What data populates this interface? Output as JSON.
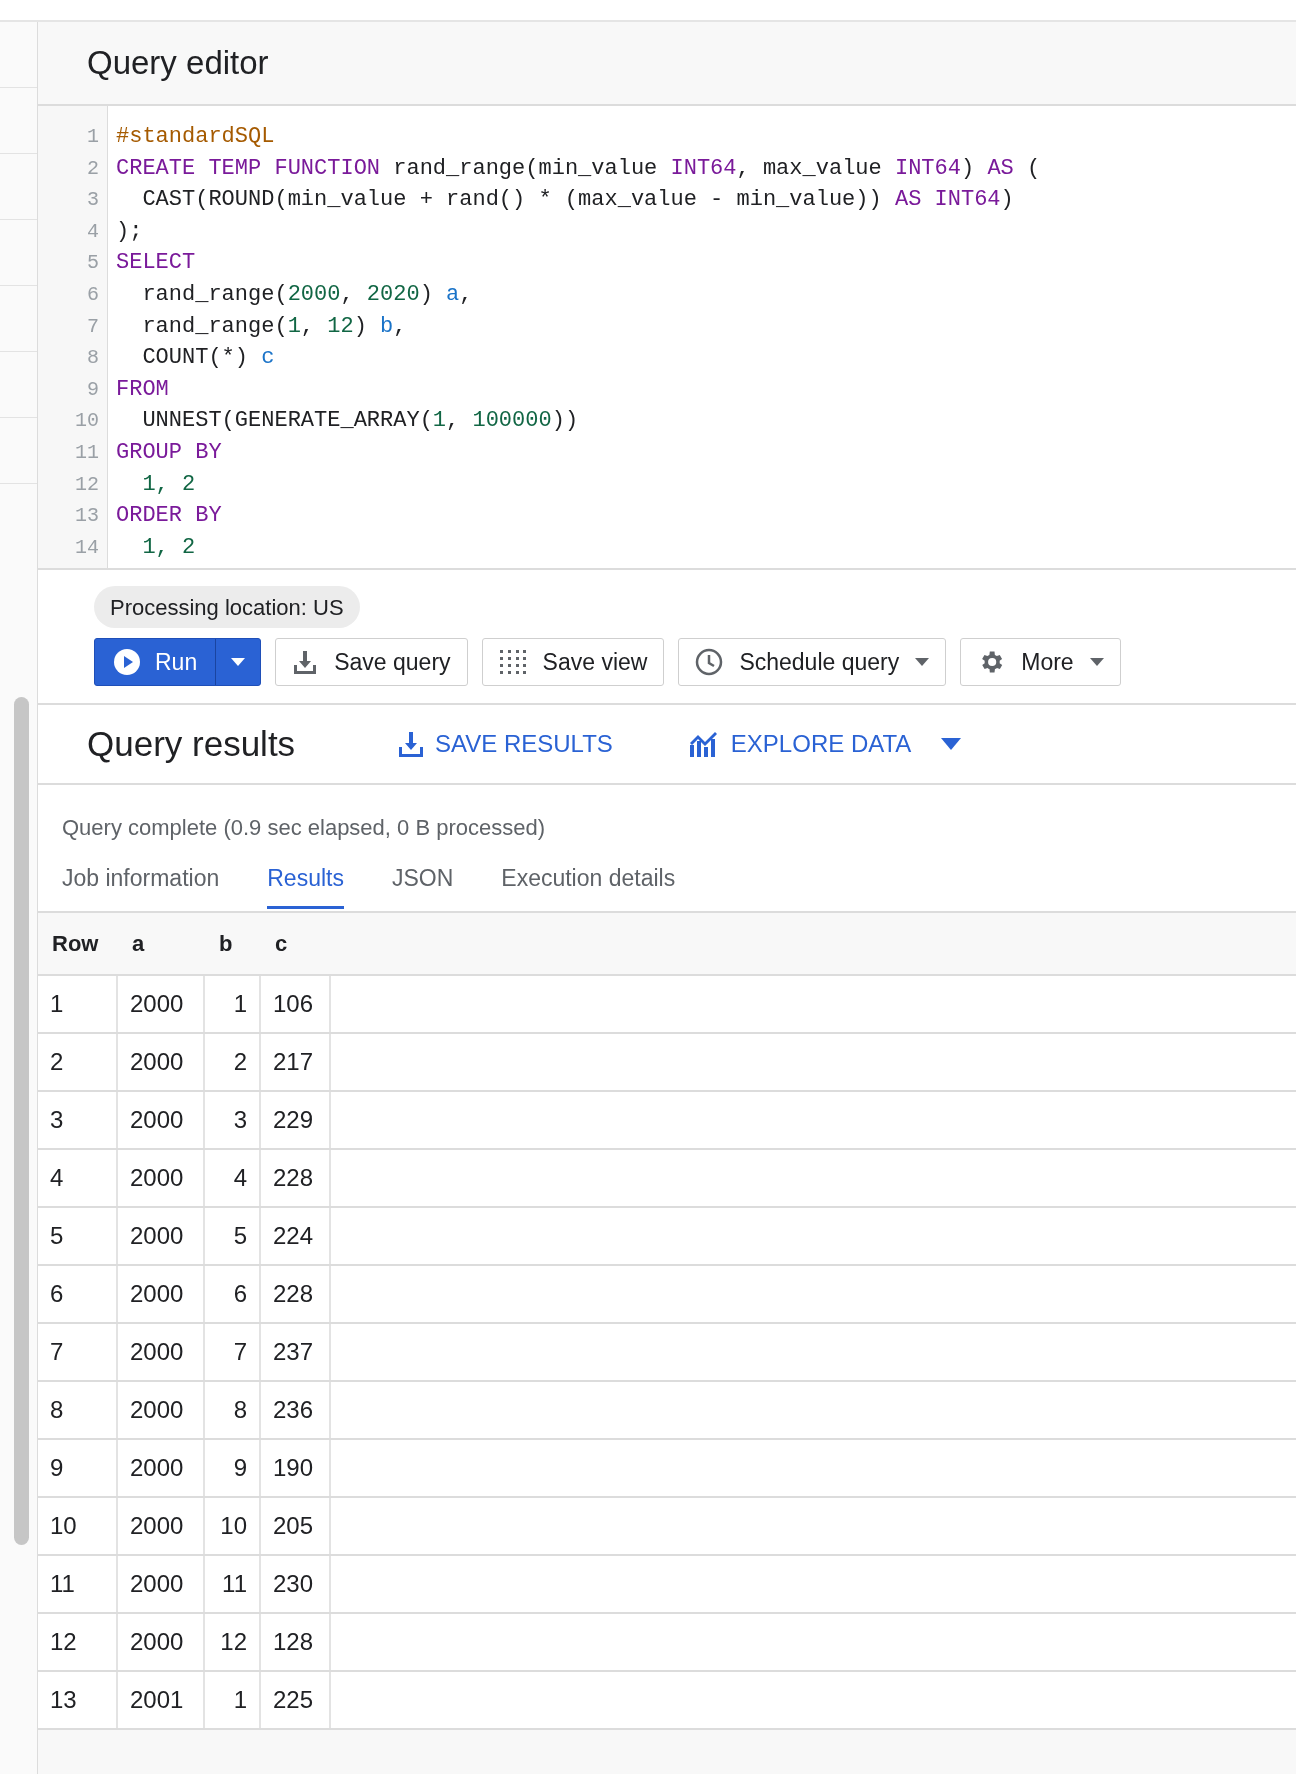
{
  "editor": {
    "title": "Query editor",
    "lines": [
      {
        "number": "1",
        "tokens": [
          {
            "kind": "comment",
            "text": "#standardSQL"
          }
        ]
      },
      {
        "number": "2",
        "tokens": [
          {
            "kind": "keyword",
            "text": "CREATE TEMP FUNCTION"
          },
          {
            "kind": "plain",
            "text": " rand_range(min_value "
          },
          {
            "kind": "keyword",
            "text": "INT64"
          },
          {
            "kind": "plain",
            "text": ", max_value "
          },
          {
            "kind": "keyword",
            "text": "INT64"
          },
          {
            "kind": "plain",
            "text": ") "
          },
          {
            "kind": "keyword",
            "text": "AS"
          },
          {
            "kind": "plain",
            "text": " ("
          }
        ]
      },
      {
        "number": "3",
        "tokens": [
          {
            "kind": "plain",
            "text": "  CAST(ROUND(min_value + rand() * (max_value - min_value)) "
          },
          {
            "kind": "keyword",
            "text": "AS INT64"
          },
          {
            "kind": "plain",
            "text": ")"
          }
        ]
      },
      {
        "number": "4",
        "tokens": [
          {
            "kind": "plain",
            "text": ");"
          }
        ]
      },
      {
        "number": "5",
        "tokens": [
          {
            "kind": "keyword",
            "text": "SELECT"
          }
        ]
      },
      {
        "number": "6",
        "tokens": [
          {
            "kind": "plain",
            "text": "  rand_range("
          },
          {
            "kind": "number",
            "text": "2000"
          },
          {
            "kind": "plain",
            "text": ", "
          },
          {
            "kind": "number",
            "text": "2020"
          },
          {
            "kind": "plain",
            "text": ") "
          },
          {
            "kind": "alias",
            "text": "a"
          },
          {
            "kind": "plain",
            "text": ","
          }
        ]
      },
      {
        "number": "7",
        "tokens": [
          {
            "kind": "plain",
            "text": "  rand_range("
          },
          {
            "kind": "number",
            "text": "1"
          },
          {
            "kind": "plain",
            "text": ", "
          },
          {
            "kind": "number",
            "text": "12"
          },
          {
            "kind": "plain",
            "text": ") "
          },
          {
            "kind": "alias",
            "text": "b"
          },
          {
            "kind": "plain",
            "text": ","
          }
        ]
      },
      {
        "number": "8",
        "tokens": [
          {
            "kind": "plain",
            "text": "  COUNT(*) "
          },
          {
            "kind": "alias",
            "text": "c"
          }
        ]
      },
      {
        "number": "9",
        "tokens": [
          {
            "kind": "keyword",
            "text": "FROM"
          }
        ]
      },
      {
        "number": "10",
        "tokens": [
          {
            "kind": "plain",
            "text": "  UNNEST(GENERATE_ARRAY("
          },
          {
            "kind": "number",
            "text": "1"
          },
          {
            "kind": "plain",
            "text": ", "
          },
          {
            "kind": "number",
            "text": "100000"
          },
          {
            "kind": "plain",
            "text": "))"
          }
        ]
      },
      {
        "number": "11",
        "tokens": [
          {
            "kind": "keyword",
            "text": "GROUP BY"
          }
        ]
      },
      {
        "number": "12",
        "tokens": [
          {
            "kind": "number",
            "text": "  1, 2"
          }
        ]
      },
      {
        "number": "13",
        "tokens": [
          {
            "kind": "keyword",
            "text": "ORDER BY"
          }
        ]
      },
      {
        "number": "14",
        "tokens": [
          {
            "kind": "number",
            "text": "  1, 2"
          }
        ]
      }
    ]
  },
  "processing_location": "Processing location: US",
  "toolbar": [
    {
      "kind": "run",
      "label": "Run",
      "dropdown": true
    },
    {
      "kind": "save",
      "label": "Save query",
      "dropdown": false
    },
    {
      "kind": "view",
      "label": "Save view",
      "dropdown": false
    },
    {
      "kind": "schedule",
      "label": "Schedule query",
      "dropdown": true
    },
    {
      "kind": "more",
      "label": "More",
      "dropdown": true
    }
  ],
  "results": {
    "title": "Query results",
    "actions": [
      {
        "kind": "save",
        "label": "SAVE RESULTS",
        "dropdown": false
      },
      {
        "kind": "explore",
        "label": "EXPLORE DATA",
        "dropdown": true
      }
    ],
    "status": "Query complete (0.9 sec elapsed, 0 B processed)",
    "tabs": [
      {
        "label": "Job information",
        "selected": false
      },
      {
        "label": "Results",
        "selected": true
      },
      {
        "label": "JSON",
        "selected": false
      },
      {
        "label": "Execution details",
        "selected": false
      }
    ],
    "table": {
      "columns": [
        "Row",
        "a",
        "b",
        "c"
      ],
      "rows": [
        [
          "1",
          "2000",
          "1",
          "106"
        ],
        [
          "2",
          "2000",
          "2",
          "217"
        ],
        [
          "3",
          "2000",
          "3",
          "229"
        ],
        [
          "4",
          "2000",
          "4",
          "228"
        ],
        [
          "5",
          "2000",
          "5",
          "224"
        ],
        [
          "6",
          "2000",
          "6",
          "228"
        ],
        [
          "7",
          "2000",
          "7",
          "237"
        ],
        [
          "8",
          "2000",
          "8",
          "236"
        ],
        [
          "9",
          "2000",
          "9",
          "190"
        ],
        [
          "10",
          "2000",
          "10",
          "205"
        ],
        [
          "11",
          "2000",
          "11",
          "230"
        ],
        [
          "12",
          "2000",
          "12",
          "128"
        ],
        [
          "13",
          "2001",
          "1",
          "225"
        ]
      ]
    }
  }
}
